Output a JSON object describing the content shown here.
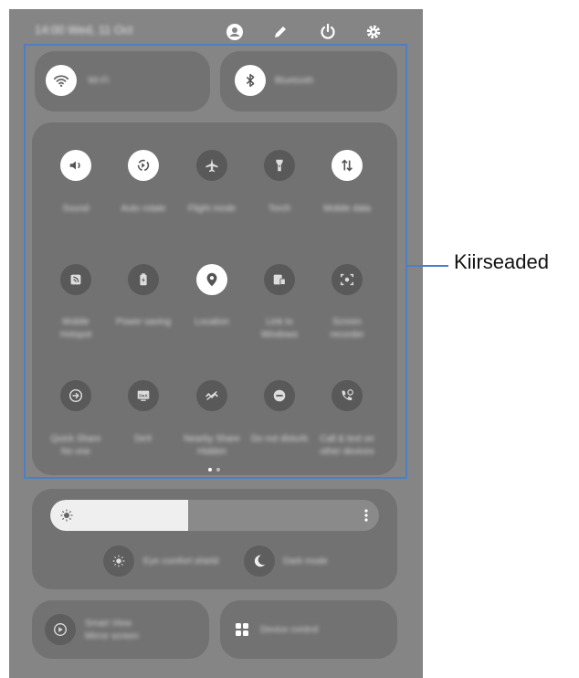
{
  "status_bar": {
    "time_date": "14:00 Wed, 11 Oct",
    "icons": [
      "person-icon",
      "pencil-icon",
      "power-icon",
      "gear-icon"
    ]
  },
  "connectivity": [
    {
      "label": "Wi-Fi",
      "icon": "wifi-icon",
      "state": "on"
    },
    {
      "label": "Bluetooth",
      "icon": "bluetooth-icon",
      "state": "on"
    }
  ],
  "quick_settings": {
    "rows": [
      [
        {
          "label": "Sound",
          "icon": "sound-icon",
          "state": "on"
        },
        {
          "label": "Auto rotate",
          "icon": "auto-rotate-icon",
          "state": "on"
        },
        {
          "label": "Flight mode",
          "icon": "airplane-icon",
          "state": "off"
        },
        {
          "label": "Torch",
          "icon": "torch-icon",
          "state": "off"
        },
        {
          "label": "Mobile data",
          "icon": "mobile-data-icon",
          "state": "on"
        }
      ],
      [
        {
          "label": "Mobile Hotspot",
          "icon": "hotspot-icon",
          "state": "off"
        },
        {
          "label": "Power saving",
          "icon": "battery-icon",
          "state": "off"
        },
        {
          "label": "Location",
          "icon": "location-icon",
          "state": "on"
        },
        {
          "label": "Link to Windows",
          "icon": "link-windows-icon",
          "state": "off"
        },
        {
          "label": "Screen recorder",
          "icon": "screen-recorder-icon",
          "state": "off"
        }
      ],
      [
        {
          "label": "Quick Share No one",
          "icon": "quick-share-icon",
          "state": "off"
        },
        {
          "label": "DeX",
          "icon": "dex-icon",
          "state": "off"
        },
        {
          "label": "Nearby Share Hidden",
          "icon": "nearby-share-icon",
          "state": "off"
        },
        {
          "label": "Do not disturb",
          "icon": "dnd-icon",
          "state": "off"
        },
        {
          "label": "Call & text on other devices",
          "icon": "call-text-icon",
          "state": "off"
        }
      ]
    ],
    "page_count": 2,
    "active_page": 1
  },
  "brightness": {
    "level_percent": 42,
    "icon": "sun-icon"
  },
  "display_toggles": [
    {
      "label": "Eye comfort shield",
      "icon": "eye-comfort-icon"
    },
    {
      "label": "Dark mode",
      "icon": "moon-icon"
    }
  ],
  "bottom": [
    {
      "label": "Smart View",
      "sublabel": "Mirror screen",
      "icon": "smart-view-icon"
    },
    {
      "label": "Device control",
      "icon": "device-control-icon"
    }
  ],
  "callout": {
    "label": "Kiirseaded"
  }
}
